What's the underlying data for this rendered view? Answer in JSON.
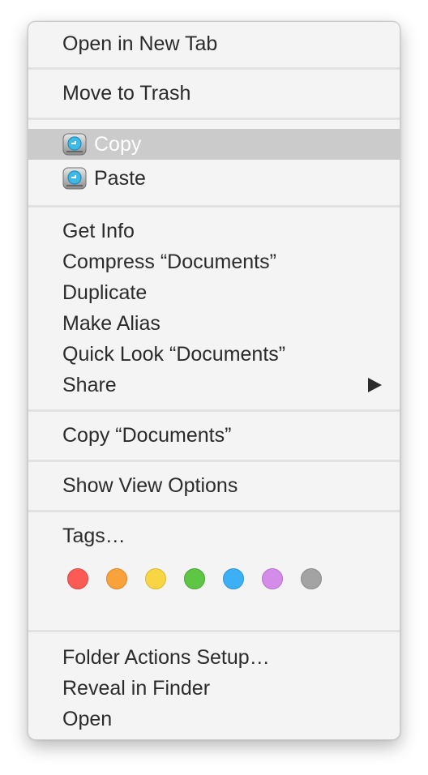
{
  "menu": {
    "open_new_tab": "Open in New Tab",
    "move_to_trash": "Move to Trash",
    "copy": "Copy",
    "paste": "Paste",
    "get_info": "Get Info",
    "compress": "Compress “Documents”",
    "duplicate": "Duplicate",
    "make_alias": "Make Alias",
    "quick_look": "Quick Look “Documents”",
    "share": "Share",
    "copy_documents": "Copy “Documents”",
    "show_view_options": "Show View Options",
    "tags": "Tags…",
    "folder_actions_setup": "Folder Actions Setup…",
    "reveal_in_finder": "Reveal in Finder",
    "open": "Open"
  },
  "highlighted_item": "Copy",
  "icons": {
    "copy": "app-drive-icon",
    "paste": "app-drive-icon",
    "share": "submenu-arrow-icon"
  },
  "tag_colors": [
    {
      "name": "red",
      "fill": "#fb5a55",
      "stroke": "#e2453f"
    },
    {
      "name": "orange",
      "fill": "#f9a13a",
      "stroke": "#e0872a"
    },
    {
      "name": "yellow",
      "fill": "#f8d543",
      "stroke": "#dfb92f"
    },
    {
      "name": "green",
      "fill": "#5ec545",
      "stroke": "#47a934"
    },
    {
      "name": "blue",
      "fill": "#3db0f5",
      "stroke": "#2a96db"
    },
    {
      "name": "purple",
      "fill": "#d38de8",
      "stroke": "#b972cf"
    },
    {
      "name": "gray",
      "fill": "#a3a3a3",
      "stroke": "#8a8a8a"
    }
  ],
  "colors": {
    "menu_background": "#f4f4f4",
    "highlight": "#cbcbcb",
    "text": "#2b2b2b"
  }
}
